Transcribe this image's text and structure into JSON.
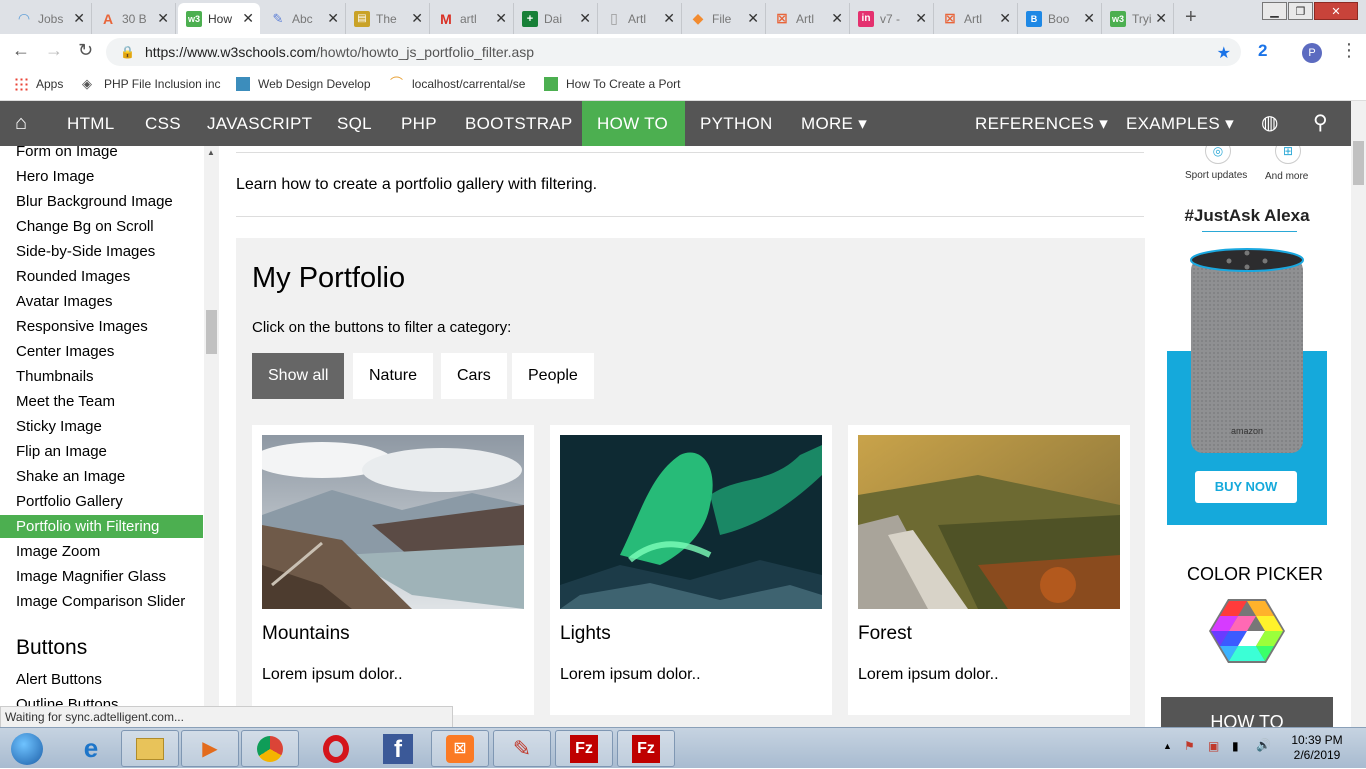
{
  "browser": {
    "tabs": [
      {
        "title": "Jobs",
        "icon": "wifi-icon",
        "color": "#5f9fd8"
      },
      {
        "title": "30 B",
        "icon": "a-letter-icon",
        "color": "#e8653a"
      },
      {
        "title": "How",
        "icon": "w3-icon",
        "color": "#4caf50",
        "active": true
      },
      {
        "title": "Abc",
        "icon": "abc-icon",
        "color": "#5a7dd6"
      },
      {
        "title": "The",
        "icon": "book-icon",
        "color": "#c9a227"
      },
      {
        "title": "artl",
        "icon": "gmail-icon",
        "color": "#d93025"
      },
      {
        "title": "Dai",
        "icon": "sheets-icon",
        "color": "#188038"
      },
      {
        "title": "Artl",
        "icon": "page-icon",
        "color": "#999999"
      },
      {
        "title": "File",
        "icon": "diamond-icon",
        "color": "#f28b30"
      },
      {
        "title": "Artl",
        "icon": "xampp-icon",
        "color": "#e8653a"
      },
      {
        "title": "v7 -",
        "icon": "invision-icon",
        "color": "#e4316f"
      },
      {
        "title": "Artl",
        "icon": "xampp-icon",
        "color": "#e8653a"
      },
      {
        "title": "Boo",
        "icon": "bootstrap-icon",
        "color": "#1e88e5"
      },
      {
        "title": "Tryi",
        "icon": "w3-icon",
        "color": "#4caf50"
      }
    ],
    "url_host": "https://www.w3schools.com",
    "url_path": "/howto/howto_js_portfolio_filter.asp",
    "extension_badge": "2",
    "profile_initial": "P",
    "bookmarks": [
      {
        "label": "Apps",
        "icon": "apps-grid-icon"
      },
      {
        "label": "PHP File Inclusion inc",
        "icon": "diamond-icon"
      },
      {
        "label": "Web Design Develop",
        "icon": "grid-icon"
      },
      {
        "label": "localhost/carrental/se",
        "icon": "curve-icon"
      },
      {
        "label": "How To Create a Port",
        "icon": "w3-icon"
      }
    ],
    "status_text": "Waiting for sync.adtelligent.com..."
  },
  "topnav": {
    "items": [
      "HTML",
      "CSS",
      "JAVASCRIPT",
      "SQL",
      "PHP",
      "BOOTSTRAP",
      "HOW TO",
      "PYTHON",
      "MORE ▾"
    ],
    "right_items": [
      "REFERENCES ▾",
      "EXAMPLES ▾"
    ],
    "active": "HOW TO"
  },
  "sidebar": {
    "items": [
      "Form on Image",
      "Hero Image",
      "Blur Background Image",
      "Change Bg on Scroll",
      "Side-by-Side Images",
      "Rounded Images",
      "Avatar Images",
      "Responsive Images",
      "Center Images",
      "Thumbnails",
      "Meet the Team",
      "Sticky Image",
      "Flip an Image",
      "Shake an Image",
      "Portfolio Gallery",
      "Portfolio with Filtering",
      "Image Zoom",
      "Image Magnifier Glass",
      "Image Comparison Slider"
    ],
    "active": "Portfolio with Filtering",
    "section_heading": "Buttons",
    "section_items": [
      "Alert Buttons",
      "Outline Buttons"
    ]
  },
  "main": {
    "intro": "Learn how to create a portfolio gallery with filtering.",
    "demo": {
      "title": "My Portfolio",
      "hint": "Click on the buttons to filter a category:",
      "filters": [
        "Show all",
        "Nature",
        "Cars",
        "People"
      ],
      "active_filter": "Show all",
      "cards": [
        {
          "title": "Mountains",
          "text": "Lorem ipsum dolor.."
        },
        {
          "title": "Lights",
          "text": "Lorem ipsum dolor.."
        },
        {
          "title": "Forest",
          "text": "Lorem ipsum dolor.."
        }
      ]
    }
  },
  "ads": {
    "icon_labels": [
      "Sport updates",
      "And more"
    ],
    "alexa_heading": "#JustAsk Alexa",
    "speaker_brand": "amazon",
    "buy_now": "BUY NOW",
    "color_picker": "COLOR PICKER",
    "howto_bottom": "HOW TO"
  },
  "taskbar": {
    "apps": [
      "windows-start-icon",
      "ie-icon",
      "explorer-icon",
      "media-player-icon",
      "chrome-icon",
      "opera-icon",
      "facebook-icon",
      "xampp-icon",
      "paint-icon",
      "filezilla-icon",
      "filezilla-icon"
    ],
    "time": "10:39 PM",
    "date": "2/6/2019"
  }
}
